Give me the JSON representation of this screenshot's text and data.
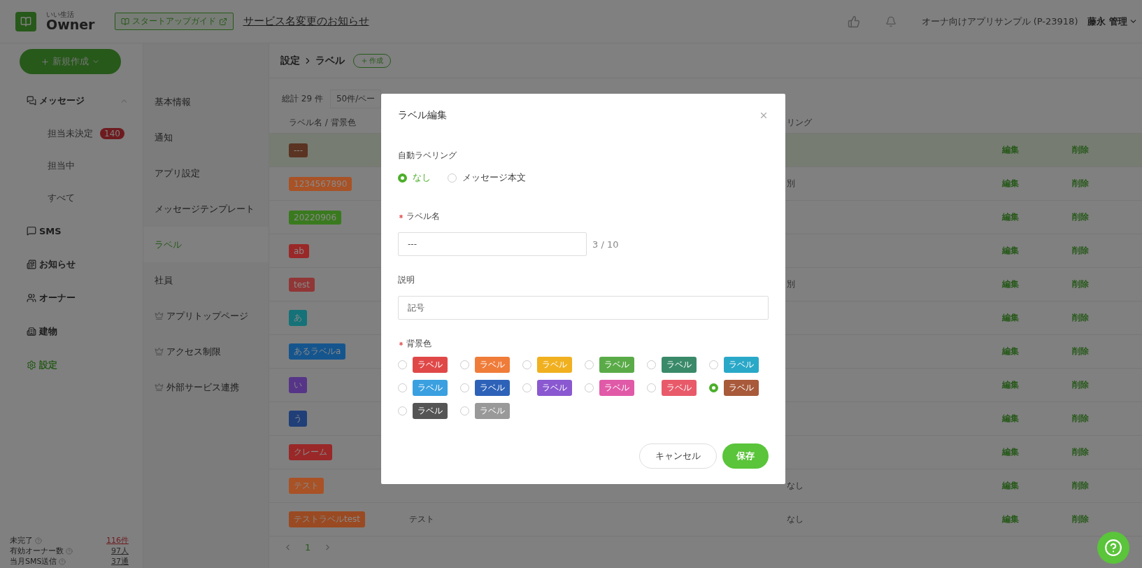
{
  "header": {
    "logo_caption": "いい生活",
    "logo": "Owner",
    "guide_button": "スタートアップガイド",
    "notice_link": "サービス名変更のお知らせ",
    "account": "オーナ向けアプリサンプル (P-23918)",
    "user": "藤永 管理"
  },
  "sidebar": {
    "create_button": "新規作成",
    "items": [
      {
        "kind": "messages",
        "label": "メッセージ",
        "selected": false,
        "expanded": true,
        "children": [
          {
            "label": "担当未決定",
            "badge": "140",
            "selected": false
          },
          {
            "label": "担当中",
            "selected": false
          },
          {
            "label": "すべて",
            "selected": false
          }
        ]
      },
      {
        "kind": "sms",
        "label": "SMS",
        "selected": false
      },
      {
        "kind": "news",
        "label": "お知らせ",
        "selected": false
      },
      {
        "kind": "owners",
        "label": "オーナー",
        "selected": false
      },
      {
        "kind": "building",
        "label": "建物",
        "selected": false
      },
      {
        "kind": "settings",
        "label": "設定",
        "selected": true
      }
    ],
    "stats": [
      {
        "label": "未完了",
        "value": "116件",
        "alert": true
      },
      {
        "label": "有効オーナー数",
        "value": "97人",
        "alert": false
      },
      {
        "label": "当月SMS送信",
        "value": "37通",
        "alert": false
      }
    ]
  },
  "submenu": [
    {
      "label": "基本情報",
      "premium": false,
      "selected": false
    },
    {
      "label": "通知",
      "premium": false,
      "selected": false
    },
    {
      "label": "アプリ設定",
      "premium": false,
      "selected": false
    },
    {
      "label": "メッセージテンプレート",
      "premium": false,
      "selected": false
    },
    {
      "label": "ラベル",
      "premium": false,
      "selected": true
    },
    {
      "label": "社員",
      "premium": false,
      "selected": false
    },
    {
      "label": "アプリトップページ",
      "premium": true,
      "selected": false
    },
    {
      "label": "アクセス制限",
      "premium": true,
      "selected": false
    },
    {
      "label": "外部サービス連携",
      "premium": true,
      "selected": false
    }
  ],
  "breadcrumb": [
    "設定",
    "ラベル"
  ],
  "create_button": "作成",
  "table": {
    "total": "総計 29 件",
    "page_size": "50件/ペー",
    "name_header": "ラベル名 / 背景色",
    "column_3_header": "リング",
    "rows": [
      {
        "label": "---",
        "color": "#5a3322",
        "edit": "編集",
        "delete": "削除",
        "selected": true
      },
      {
        "label": "1234567890",
        "color": "#a85226",
        "column_3": "別",
        "edit": "編集",
        "delete": "削除",
        "selected": false
      },
      {
        "label": "20220906",
        "color": "#3a7a1e",
        "edit": "編集",
        "delete": "削除",
        "selected": false
      },
      {
        "label": "ab",
        "color": "#9a2828",
        "edit": "編集",
        "delete": "削除",
        "selected": false
      },
      {
        "label": "test",
        "color": "#913636",
        "column_3": "別",
        "edit": "編集",
        "delete": "削除",
        "selected": false
      },
      {
        "label": "あ",
        "color": "#157278",
        "edit": "編集",
        "delete": "削除",
        "selected": false
      },
      {
        "label": "あるラベルa",
        "color": "#15558e",
        "edit": "編集",
        "delete": "削除",
        "selected": false
      },
      {
        "label": "い",
        "color": "#563588",
        "edit": "編集",
        "delete": "削除",
        "selected": false
      },
      {
        "label": "う",
        "color": "#203f78",
        "edit": "編集",
        "delete": "削除",
        "selected": false
      },
      {
        "label": "クレーム",
        "color": "#9a2828",
        "edit": "編集",
        "delete": "削除",
        "selected": false
      },
      {
        "label": "テスト",
        "color": "#a85226",
        "column_3": "なし",
        "edit": "編集",
        "delete": "削除",
        "selected": false
      },
      {
        "label": "テストラベルtest",
        "color": "#9a4a22",
        "column_2": "テスト",
        "column_3": "なし",
        "edit": "編集",
        "delete": "削除",
        "selected": false
      }
    ],
    "page": "1"
  },
  "modal": {
    "title": "ラベル編集",
    "auto_label": {
      "label": "自動ラベリング",
      "options": [
        {
          "label": "なし",
          "selected": true
        },
        {
          "label": "メッセージ本文",
          "selected": false
        }
      ]
    },
    "name": {
      "label": "ラベル名",
      "required": true,
      "value": "---",
      "counter": "3 / 10"
    },
    "description": {
      "label": "説明",
      "value": "記号"
    },
    "color": {
      "label": "背景色",
      "required": true,
      "options": [
        {
          "label": "ラベル",
          "color": "#e04848",
          "selected": false
        },
        {
          "label": "ラベル",
          "color": "#f07c3a",
          "selected": false
        },
        {
          "label": "ラベル",
          "color": "#f0b020",
          "selected": false
        },
        {
          "label": "ラベル",
          "color": "#5aab48",
          "selected": false
        },
        {
          "label": "ラベル",
          "color": "#3a8a6a",
          "selected": false
        },
        {
          "label": "ラベル",
          "color": "#2aa8c8",
          "selected": false
        },
        {
          "label": "ラベル",
          "color": "#3aa0e0",
          "selected": false
        },
        {
          "label": "ラベル",
          "color": "#2d62b8",
          "selected": false
        },
        {
          "label": "ラベル",
          "color": "#8a58d0",
          "selected": false
        },
        {
          "label": "ラベル",
          "color": "#e05aa8",
          "selected": false
        },
        {
          "label": "ラベル",
          "color": "#e85a6a",
          "selected": false
        },
        {
          "label": "ラベル",
          "color": "#a85a3a",
          "selected": true
        },
        {
          "label": "ラベル",
          "color": "#555555",
          "selected": false
        },
        {
          "label": "ラベル",
          "color": "#999999",
          "selected": false
        }
      ]
    },
    "cancel": "キャンセル",
    "save": "保存"
  }
}
